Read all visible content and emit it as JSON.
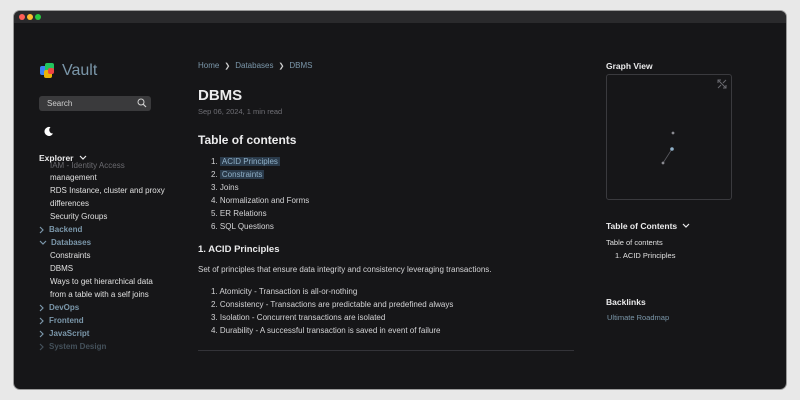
{
  "sidebar": {
    "title": "Vault",
    "search_placeholder": "Search",
    "explorer_label": "Explorer",
    "tree": [
      {
        "kind": "cut",
        "label": "IAM - Identity Access"
      },
      {
        "kind": "leaf",
        "label": "management"
      },
      {
        "kind": "leaf",
        "label": "RDS Instance, cluster and proxy"
      },
      {
        "kind": "leaf",
        "label": "differences"
      },
      {
        "kind": "leaf",
        "label": "Security Groups"
      },
      {
        "kind": "folder",
        "label": "Backend",
        "open": false
      },
      {
        "kind": "folder",
        "label": "Databases",
        "open": true
      },
      {
        "kind": "leaf",
        "label": "Constraints"
      },
      {
        "kind": "leaf",
        "label": "DBMS"
      },
      {
        "kind": "leaf",
        "label": "Ways to get hierarchical data"
      },
      {
        "kind": "leaf",
        "label": "from a table with a self joins"
      },
      {
        "kind": "folder",
        "label": "DevOps",
        "open": false
      },
      {
        "kind": "folder",
        "label": "Frontend",
        "open": false
      },
      {
        "kind": "folder",
        "label": "JavaScript",
        "open": false
      },
      {
        "kind": "folder",
        "label": "System Design",
        "open": false,
        "faded": true
      }
    ]
  },
  "breadcrumb": [
    "Home",
    "Databases",
    "DBMS"
  ],
  "article": {
    "title": "DBMS",
    "meta": "Sep 06, 2024,  1 min read",
    "toc_heading": "Table of contents",
    "toc": [
      {
        "label": "1. ",
        "link": "ACID Principles"
      },
      {
        "label": "2. ",
        "link": "Constraints"
      },
      {
        "label": "3. Joins"
      },
      {
        "label": "4. Normalization and Forms"
      },
      {
        "label": "5. ER Relations"
      },
      {
        "label": "6. SQL Questions"
      }
    ],
    "section_heading": "1. ACID Principles",
    "section_text": "Set of principles that ensure data integrity and consistency leveraging transactions.",
    "acid_list": [
      "1. Atomicity - Transaction is all-or-nothing",
      "2. Consistency - Transactions are predictable and predefined always",
      "3. Isolation - Concurrent transactions are isolated",
      "4. Durability - A successful transaction is saved in event of failure"
    ]
  },
  "right": {
    "graph_title": "Graph View",
    "toc_title": "Table of Contents",
    "toc_item1": "Table of contents",
    "toc_item2": "1. ACID Principles",
    "backlinks_title": "Backlinks",
    "backlink": "Ultimate Roadmap"
  },
  "colors": {
    "accent": "#7b97aa",
    "background": "#161618",
    "text": "#ebebec"
  }
}
